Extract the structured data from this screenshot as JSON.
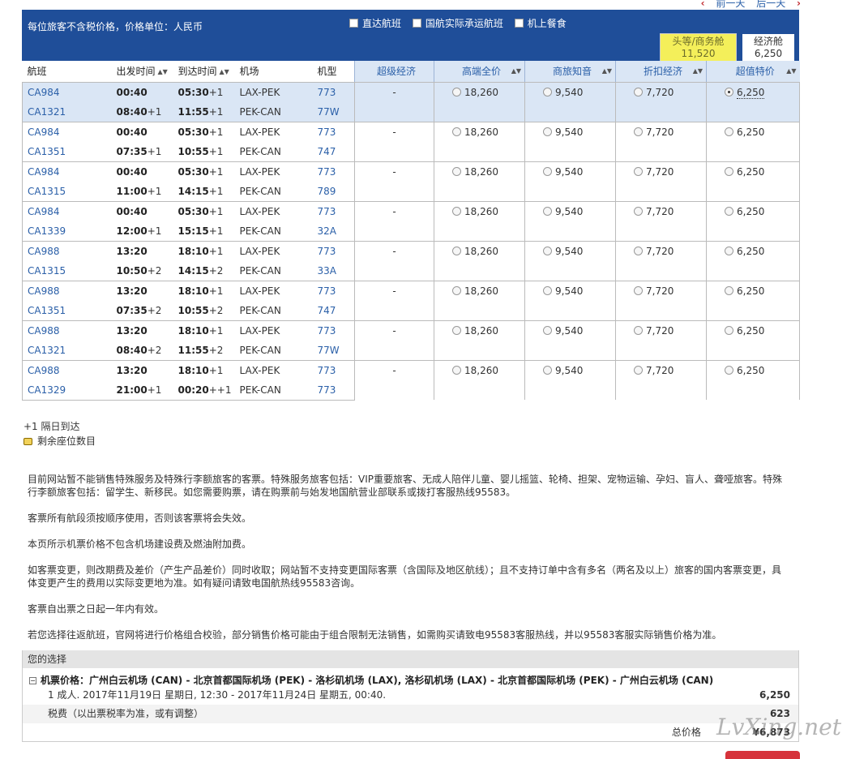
{
  "day_nav": {
    "prev": "前一天",
    "next": "后一天"
  },
  "header": {
    "note": "每位旅客不含税价格，价格单位：人民币",
    "filters": [
      "直达航班",
      "国航实际承运航班",
      "机上餐食"
    ],
    "cabins": [
      {
        "label": "头等/商务舱",
        "price": "11,520"
      },
      {
        "label": "经济舱",
        "price": "6,250"
      }
    ]
  },
  "table": {
    "columns": [
      "航班",
      "出发时间",
      "到达时间",
      "机场",
      "机型"
    ],
    "fare_columns": [
      "超级经济",
      "高端全价",
      "商旅知音",
      "折扣经济",
      "超值特价"
    ],
    "rows": [
      {
        "legs": [
          {
            "flight": "CA984",
            "dep": "00:40",
            "dep_plus": "",
            "arr": "05:30",
            "arr_plus": "+1",
            "airport": "LAX-PEK",
            "ac": "773"
          },
          {
            "flight": "CA1321",
            "dep": "08:40",
            "dep_plus": "+1",
            "arr": "11:55",
            "arr_plus": "+1",
            "airport": "PEK-CAN",
            "ac": "77W"
          }
        ],
        "super": "-",
        "fares": [
          "18,260",
          "9,540",
          "7,720",
          "6,250"
        ],
        "selected": true
      },
      {
        "legs": [
          {
            "flight": "CA984",
            "dep": "00:40",
            "dep_plus": "",
            "arr": "05:30",
            "arr_plus": "+1",
            "airport": "LAX-PEK",
            "ac": "773"
          },
          {
            "flight": "CA1351",
            "dep": "07:35",
            "dep_plus": "+1",
            "arr": "10:55",
            "arr_plus": "+1",
            "airport": "PEK-CAN",
            "ac": "747"
          }
        ],
        "super": "-",
        "fares": [
          "18,260",
          "9,540",
          "7,720",
          "6,250"
        ],
        "selected": false
      },
      {
        "legs": [
          {
            "flight": "CA984",
            "dep": "00:40",
            "dep_plus": "",
            "arr": "05:30",
            "arr_plus": "+1",
            "airport": "LAX-PEK",
            "ac": "773"
          },
          {
            "flight": "CA1315",
            "dep": "11:00",
            "dep_plus": "+1",
            "arr": "14:15",
            "arr_plus": "+1",
            "airport": "PEK-CAN",
            "ac": "789"
          }
        ],
        "super": "-",
        "fares": [
          "18,260",
          "9,540",
          "7,720",
          "6,250"
        ],
        "selected": false
      },
      {
        "legs": [
          {
            "flight": "CA984",
            "dep": "00:40",
            "dep_plus": "",
            "arr": "05:30",
            "arr_plus": "+1",
            "airport": "LAX-PEK",
            "ac": "773"
          },
          {
            "flight": "CA1339",
            "dep": "12:00",
            "dep_plus": "+1",
            "arr": "15:15",
            "arr_plus": "+1",
            "airport": "PEK-CAN",
            "ac": "32A"
          }
        ],
        "super": "-",
        "fares": [
          "18,260",
          "9,540",
          "7,720",
          "6,250"
        ],
        "selected": false
      },
      {
        "legs": [
          {
            "flight": "CA988",
            "dep": "13:20",
            "dep_plus": "",
            "arr": "18:10",
            "arr_plus": "+1",
            "airport": "LAX-PEK",
            "ac": "773"
          },
          {
            "flight": "CA1315",
            "dep": "10:50",
            "dep_plus": "+2",
            "arr": "14:15",
            "arr_plus": "+2",
            "airport": "PEK-CAN",
            "ac": "33A"
          }
        ],
        "super": "-",
        "fares": [
          "18,260",
          "9,540",
          "7,720",
          "6,250"
        ],
        "selected": false
      },
      {
        "legs": [
          {
            "flight": "CA988",
            "dep": "13:20",
            "dep_plus": "",
            "arr": "18:10",
            "arr_plus": "+1",
            "airport": "LAX-PEK",
            "ac": "773"
          },
          {
            "flight": "CA1351",
            "dep": "07:35",
            "dep_plus": "+2",
            "arr": "10:55",
            "arr_plus": "+2",
            "airport": "PEK-CAN",
            "ac": "747"
          }
        ],
        "super": "-",
        "fares": [
          "18,260",
          "9,540",
          "7,720",
          "6,250"
        ],
        "selected": false
      },
      {
        "legs": [
          {
            "flight": "CA988",
            "dep": "13:20",
            "dep_plus": "",
            "arr": "18:10",
            "arr_plus": "+1",
            "airport": "LAX-PEK",
            "ac": "773"
          },
          {
            "flight": "CA1321",
            "dep": "08:40",
            "dep_plus": "+2",
            "arr": "11:55",
            "arr_plus": "+2",
            "airport": "PEK-CAN",
            "ac": "77W"
          }
        ],
        "super": "-",
        "fares": [
          "18,260",
          "9,540",
          "7,720",
          "6,250"
        ],
        "selected": false
      },
      {
        "legs": [
          {
            "flight": "CA988",
            "dep": "13:20",
            "dep_plus": "",
            "arr": "18:10",
            "arr_plus": "+1",
            "airport": "LAX-PEK",
            "ac": "773"
          },
          {
            "flight": "CA1329",
            "dep": "21:00",
            "dep_plus": "+1",
            "arr": "00:20",
            "arr_plus": "++1",
            "airport": "PEK-CAN",
            "ac": "773"
          }
        ],
        "super": "-",
        "fares": [
          "18,260",
          "9,540",
          "7,720",
          "6,250"
        ],
        "selected": false
      }
    ]
  },
  "legend": {
    "next_day": "+1 隔日到达",
    "seats": "剩余座位数目"
  },
  "notices": [
    "目前网站暂不能销售特殊服务及特殊行李额旅客的客票。特殊服务旅客包括：VIP重要旅客、无成人陪伴儿童、婴儿摇篮、轮椅、担架、宠物运输、孕妇、盲人、聋哑旅客。特殊行李额旅客包括：留学生、新移民。如您需要购票，请在购票前与始发地国航营业部联系或拨打客服热线95583。",
    "客票所有航段须按顺序使用，否则该客票将会失效。",
    "本页所示机票价格不包含机场建设费及燃油附加费。",
    "如客票变更，则改期费及差价（产生产品差价）同时收取；网站暂不支持变更国际客票（含国际及地区航线）；且不支持订单中含有多名（两名及以上）旅客的国内客票变更，具体变更产生的费用以实际变更地为准。如有疑问请致电国航热线95583咨询。",
    "客票自出票之日起一年内有效。",
    "若您选择往返航班，官网将进行价格组合校验，部分销售价格可能由于组合限制无法销售，如需购买请致电95583客服热线，并以95583客服实际销售价格为准。"
  ],
  "choice": {
    "title": "您的选择",
    "route": "机票价格：广州白云机场 (CAN) - 北京首都国际机场 (PEK) - 洛杉矶机场 (LAX), 洛杉矶机场 (LAX) - 北京首都国际机场 (PEK) - 广州白云机场 (CAN)",
    "passenger_line": "1 成人. 2017年11月19日 星期日, 12:30 - 2017年11月24日 星期五, 00:40.",
    "passenger_amount": "6,250",
    "tax_label": "税费（以出票税率为准，或有调整）",
    "tax_amount": "623",
    "total_label": "总价格",
    "total_amount": "¥6,873"
  },
  "watermark": "LvXing.net",
  "colors": {
    "brand_blue": "#1f4e99",
    "fare_header": "#dae6f5",
    "first_cabin": "#f4ef5a",
    "buy_button": "#d6333b"
  }
}
